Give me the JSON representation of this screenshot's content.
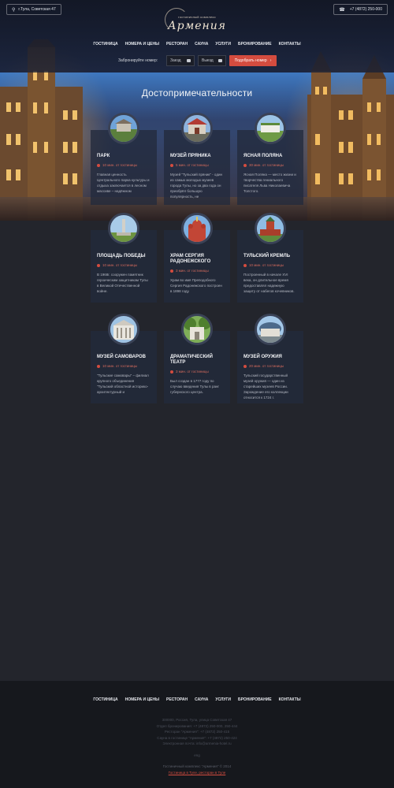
{
  "header": {
    "address": "г.Тула, Советская 47",
    "phone": "+7 (4872) 250-000",
    "logo_subtitle": "гостиничный комплекс",
    "logo_name": "Армения"
  },
  "nav": [
    "Гостиница",
    "Номера и цены",
    "Ресторан",
    "Сауна",
    "Услуги",
    "Бронирование",
    "Контакты"
  ],
  "booking": {
    "label": "Забронируйте номер:",
    "checkin": "Заезд",
    "checkout": "Выезд",
    "button": "Подобрать номер"
  },
  "section": {
    "title": "Достопримечательности"
  },
  "cards": [
    {
      "title": "Парк",
      "distance": "10 мин. от гостиницы",
      "text": "Главная ценность Центрального парка культуры и отдыха заключается в лесном массиве – надёжном"
    },
    {
      "title": "Музей пряника",
      "distance": "5 мин. от гостиницы",
      "text": "Музей \"Тульский пряник\" - один из самых молодых музеев города Тулы, но за два года он приобрёл большую популярность, не"
    },
    {
      "title": "Ясная поляна",
      "distance": "30 мин. от гостиницы",
      "text": "Ясная Поляна — место жизни и творчества гениального писателя Льва Николаевича Толстого."
    },
    {
      "title": "Площадь победы",
      "distance": "10 мин. от гостиницы",
      "text": "В 1968г. сооружен памятник героическим защитникам Тулы в Великой Отечественной войне."
    },
    {
      "title": "Храм Сергия Радонежского",
      "distance": "3 мин. от гостиницы",
      "text": "Храм во имя Преподобного Сергия Радонежского построен в 1898 году."
    },
    {
      "title": "Тульский Кремль",
      "distance": "10 мин. от гостиницы",
      "text": "Построенный в начале XVI века, он длительное время предоставлял надежную защиту от набегов кочевников."
    },
    {
      "title": "Музей самоваров",
      "distance": "10 мин. от гостиницы",
      "text": "\"Тульские самовары\" – филиал крупного объединения \"Тульский областной историко-архитектурный и"
    },
    {
      "title": "Драматический театр",
      "distance": "3 мин. от гостиницы",
      "text": "Был создан в 1777 году по случаю введения Тулы в ранг губернского центра."
    },
    {
      "title": "Музей оружия",
      "distance": "20 мин. от гостиницы",
      "text": "Тульский государственный музей оружия — один из старейших музеев России. Зарождение его коллекции относится к 1724 г."
    }
  ],
  "footer": {
    "nav": [
      "Гостиница",
      "Номера и цены",
      "Ресторан",
      "Сауна",
      "Услуги",
      "Бронирование",
      "Контакты"
    ],
    "info": [
      "300000, Россия, Тула, улица Советская 47",
      "Отдел бронирования: +7 (4872) 250-000, 250-444",
      "Ресторан \"Армения\": +7 (4872) 250-415",
      "Сауна в гостинице \"Армения\": +7 (4872) 250-424",
      "Электронная почта: info@armenia-hotel.ru"
    ],
    "lang": "eng",
    "copyright": "Гостиничный комплекс \"Армения\" © 2014",
    "links": "Гостиница в Туле, ресторан в Туле"
  }
}
